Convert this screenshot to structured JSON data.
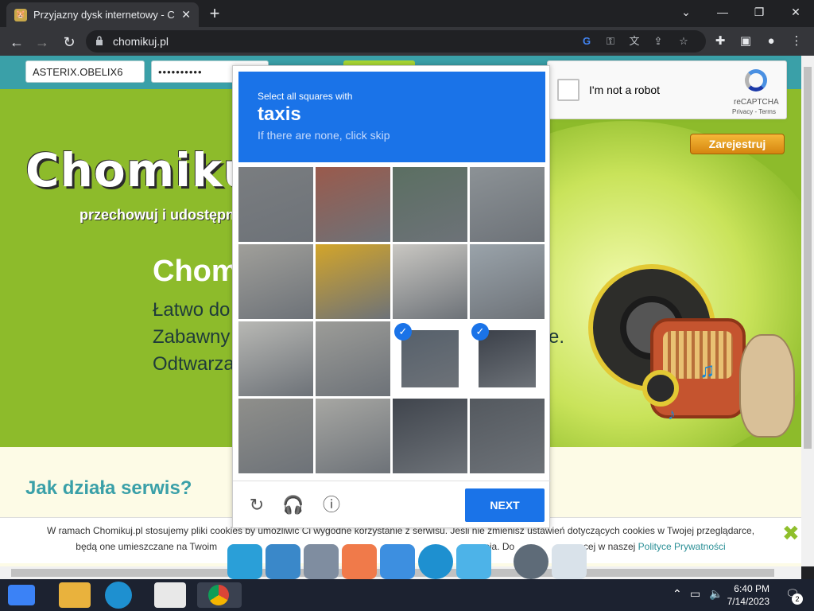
{
  "browser": {
    "tab_title": "Przyjazny dysk internetowy - Cho",
    "tab_favicon": "chomik-favicon-icon",
    "url": "chomikuj.pl"
  },
  "site": {
    "login_value": "ASTERIX.OBELIX6",
    "password_value": "••••••••••",
    "logo_text": "Chomikuj.",
    "tagline": "przechowuj i udostępni",
    "hero_title": "Chom",
    "hero_lines": [
      "Łatwo do",
      "Zabawny",
      "Odtwarza"
    ],
    "hero_right_fragment": "e.",
    "register_label": "Zarejestruj",
    "how_heading": "Jak działa serwis?",
    "cookie_line1": "W ramach Chomikuj.pl stosujemy pliki cookies by umożliwić Ci wygodne korzystanie z serwisu. Jeśli nie zmienisz ustawień dotyczących cookies w Twojej przeglądarce,",
    "cookie_line2_a": "będą one umieszczane na Twoim",
    "cookie_line2_b": "cja. Do",
    "cookie_line2_c": "cej w naszej",
    "cookie_link": "Polityce Prywatności",
    "cookie_close": "✖"
  },
  "recaptcha": {
    "label": "I'm not a robot",
    "brand": "reCAPTCHA",
    "terms": "Privacy - Terms"
  },
  "challenge": {
    "instruction": "Select all squares with",
    "target": "taxis",
    "hint": "If there are none, click skip",
    "next_label": "NEXT",
    "selected_tiles": [
      10,
      11
    ],
    "footer_icons": [
      "reload-icon",
      "audio-icon",
      "info-icon"
    ]
  },
  "taskbar": {
    "time": "6:40 PM",
    "date": "7/14/2023",
    "notification_count": "2"
  },
  "colors": {
    "accent_blue": "#1a73e8",
    "site_teal": "#3aa0a8",
    "hero_green": "#8dbb2b",
    "register_orange": "#e59a1f"
  }
}
